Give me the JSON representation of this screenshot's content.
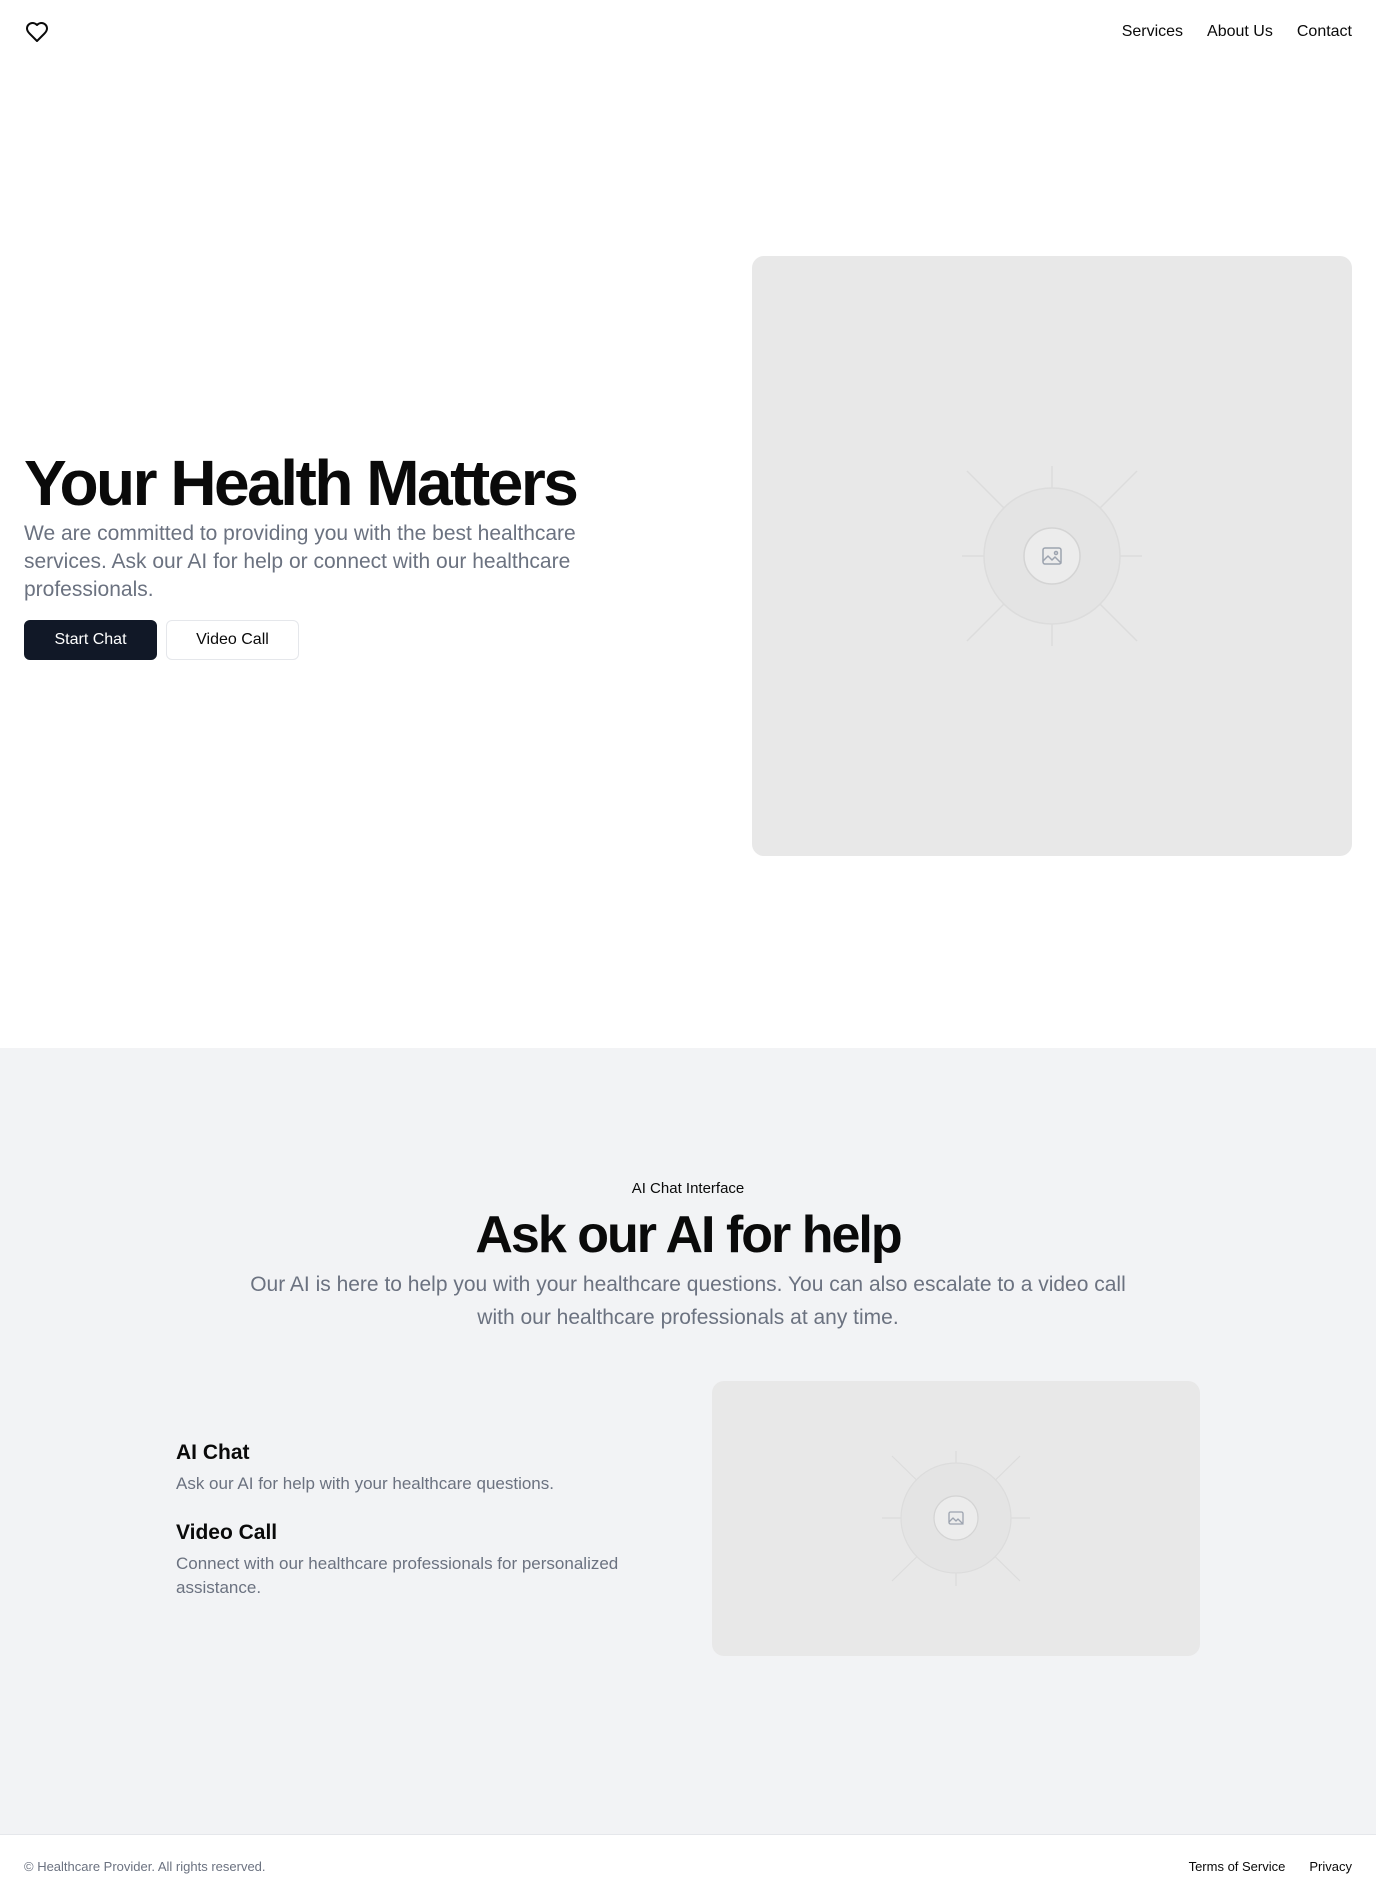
{
  "header": {
    "logo_icon": "heart-icon",
    "nav": [
      "Services",
      "About Us",
      "Contact"
    ]
  },
  "hero": {
    "title": "Your Health Matters",
    "subtitle": "We are committed to providing you with the best healthcare services. Ask our AI for help or connect with our healthcare professionals.",
    "primary_button": "Start Chat",
    "secondary_button": "Video Call",
    "image_icon": "image-placeholder-icon"
  },
  "ai_section": {
    "eyebrow": "AI Chat Interface",
    "title": "Ask our AI for help",
    "subtitle": "Our AI is here to help you with your healthcare questions. You can also escalate to a video call with our healthcare professionals at any time.",
    "features": [
      {
        "title": "AI Chat",
        "description": "Ask our AI for help with your healthcare questions."
      },
      {
        "title": "Video Call",
        "description": "Connect with our healthcare professionals for personalized assistance."
      }
    ],
    "image_icon": "image-placeholder-icon"
  },
  "footer": {
    "copyright": "© Healthcare Provider. All rights reserved.",
    "links": [
      "Terms of Service",
      "Privacy"
    ]
  },
  "colors": {
    "primary_button_bg": "#111827",
    "muted_text": "#6b7280",
    "section_bg": "#f2f3f5",
    "placeholder_bg": "#e8e8e8"
  }
}
